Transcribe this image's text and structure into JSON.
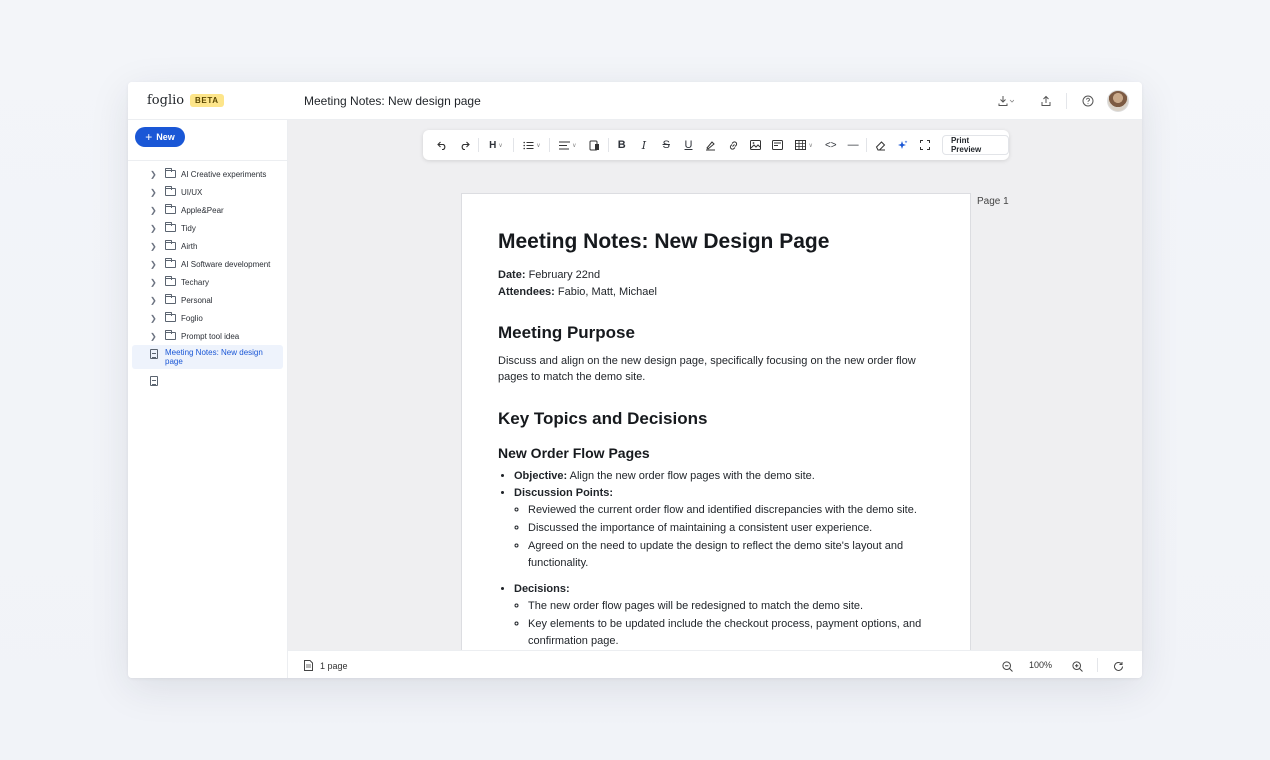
{
  "app": {
    "name": "foglio",
    "badge": "BETA"
  },
  "header": {
    "doc_title": "Meeting Notes: New design page"
  },
  "sidebar": {
    "new_label": "New",
    "folders": [
      "AI Creative experiments",
      "UI/UX",
      "Apple&Pear",
      "Tidy",
      "Airth",
      "AI Software development",
      "Techary",
      "Personal",
      "Foglio",
      "Prompt tool idea"
    ],
    "active_doc": "Meeting Notes: New design page"
  },
  "toolbar": {
    "heading_label": "H",
    "print_preview": "Print Preview"
  },
  "document": {
    "page_label": "Page 1",
    "title": "Meeting Notes: New Design Page",
    "date_label": "Date:",
    "date_value": "February 22nd",
    "attendees_label": "Attendees:",
    "attendees_value": "Fabio, Matt, Michael",
    "purpose_heading": "Meeting Purpose",
    "purpose_text": "Discuss and align on the new design page, specifically focusing on the new order flow pages to match the demo site.",
    "topics_heading": "Key Topics and Decisions",
    "section_heading": "New Order Flow Pages",
    "objective_label": "Objective:",
    "objective_text": "Align the new order flow pages with the demo site.",
    "discussion_label": "Discussion Points:",
    "discussion_points": [
      "Reviewed the current order flow and identified discrepancies with the demo site.",
      "Discussed the importance of maintaining a consistent user experience.",
      "Agreed on the need to update the design to reflect the demo site's layout and functionality."
    ],
    "decisions_label": "Decisions:",
    "decisions": [
      "The new order flow pages will be redesigned to match the demo site.",
      "Key elements to be updated include the checkout process, payment options, and confirmation page."
    ]
  },
  "status": {
    "pages": "1 page",
    "zoom": "100%"
  },
  "colors": {
    "accent": "#1a57d6",
    "beta_bg": "#fde58a",
    "canvas": "#efeff1"
  }
}
